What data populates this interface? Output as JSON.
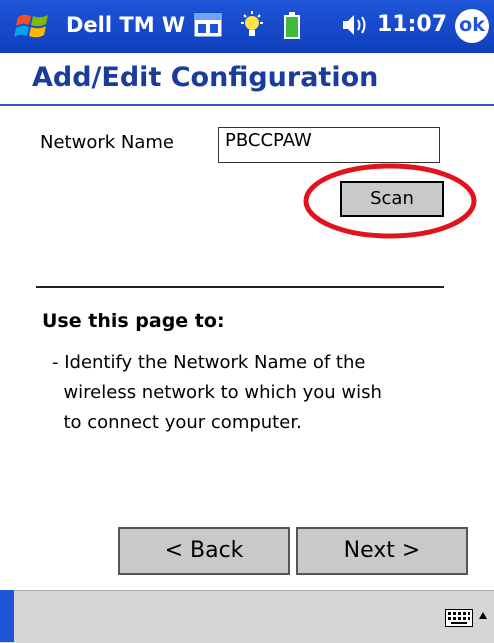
{
  "statusbar": {
    "app_title": "Dell TM W",
    "time": "11:07",
    "ok_label": "ok"
  },
  "page": {
    "title": "Add/Edit Configuration"
  },
  "form": {
    "network_name_label": "Network Name",
    "network_name_value": "PBCCPAW",
    "scan_label": "Scan"
  },
  "help": {
    "heading": "Use this page to:",
    "body": "- Identify the Network Name of the\n  wireless network to which you wish\n  to connect your computer."
  },
  "nav": {
    "back_label": "< Back",
    "next_label": "Next >"
  },
  "colors": {
    "titlebar": "#1f55d8",
    "title_text": "#1a3c9c",
    "highlight_circle": "#e0141e"
  },
  "icons": [
    "windows-start-icon",
    "network-icon",
    "bulb-icon",
    "battery-icon",
    "volume-icon",
    "keyboard-icon",
    "up-arrow-icon"
  ]
}
